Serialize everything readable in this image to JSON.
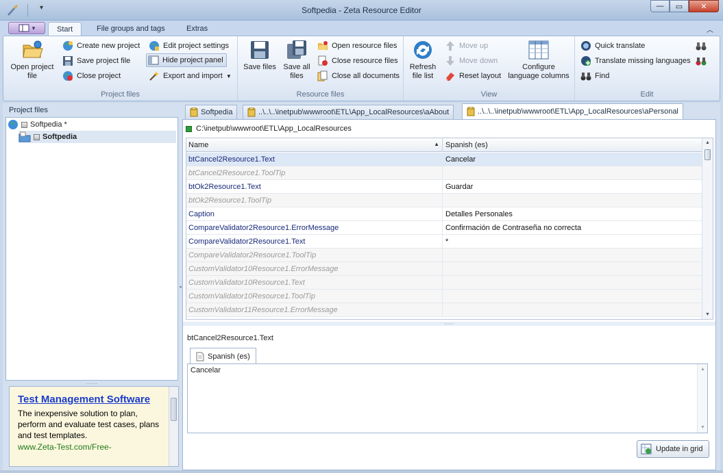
{
  "window": {
    "title": "Softpedia - Zeta Resource Editor"
  },
  "ribbon_tabs": [
    {
      "label": "Start",
      "active": true
    },
    {
      "label": "File groups and tags",
      "active": false
    },
    {
      "label": "Extras",
      "active": false
    }
  ],
  "ribbon": {
    "project_files": {
      "label": "Project files",
      "open_project_file": "Open project file",
      "create_new_project": "Create new project",
      "save_project_file": "Save project file",
      "close_project": "Close project",
      "edit_project_settings": "Edit project settings",
      "hide_project_panel": "Hide project panel",
      "export_and_import": "Export and import"
    },
    "resource_files": {
      "label": "Resource files",
      "save_files": "Save files",
      "save_all_files": "Save all files",
      "open_resource_files": "Open resource files",
      "close_resource_files": "Close resource files",
      "close_all_documents": "Close all documents"
    },
    "view": {
      "label": "View",
      "refresh_file_list": "Refresh file list",
      "move_up": "Move up",
      "move_down": "Move down",
      "reset_layout": "Reset layout",
      "configure_language_columns": "Configure language columns"
    },
    "edit": {
      "label": "Edit",
      "quick_translate": "Quick translate",
      "translate_missing_languages": "Translate missing languages",
      "find": "Find"
    }
  },
  "left_panel": {
    "header": "Project files",
    "tree": [
      {
        "label": "Softpedia *",
        "level": 0
      },
      {
        "label": "Softpedia",
        "level": 1,
        "selected": true
      }
    ],
    "ad": {
      "title": "Test Management Software",
      "body": "The inexpensive solution to plan, perform and evaluate test cases, plans and test templates.",
      "url": "www.Zeta-Test.com/Free-"
    }
  },
  "doc_tabs": [
    {
      "label": "Softpedia",
      "active": false
    },
    {
      "label": "..\\..\\..\\inetpub\\wwwroot\\ETL\\App_LocalResources\\aAbout",
      "active": false
    },
    {
      "label": "..\\..\\..\\inetpub\\wwwroot\\ETL\\App_LocalResources\\aPersonal",
      "active": true
    }
  ],
  "path": "C:\\inetpub\\wwwroot\\ETL\\App_LocalResources",
  "grid": {
    "columns": [
      "Name",
      "Spanish (es)"
    ],
    "rows": [
      {
        "name": "btCancel2Resource1.Text",
        "es": "Cancelar",
        "tooltip": false,
        "selected": true
      },
      {
        "name": "btCancel2Resource1.ToolTip",
        "es": "",
        "tooltip": true
      },
      {
        "name": "btOk2Resource1.Text",
        "es": "Guardar",
        "tooltip": false
      },
      {
        "name": "btOk2Resource1.ToolTip",
        "es": "",
        "tooltip": true
      },
      {
        "name": "Caption",
        "es": "Detalles Personales",
        "tooltip": false
      },
      {
        "name": "CompareValidator2Resource1.ErrorMessage",
        "es": "Confirmación de Contraseña no correcta",
        "tooltip": false
      },
      {
        "name": "CompareValidator2Resource1.Text",
        "es": "*",
        "tooltip": false
      },
      {
        "name": "CompareValidator2Resource1.ToolTip",
        "es": "",
        "tooltip": true
      },
      {
        "name": "CustomValidator10Resource1.ErrorMessage",
        "es": "",
        "tooltip": true
      },
      {
        "name": "CustomValidator10Resource1.Text",
        "es": "",
        "tooltip": true
      },
      {
        "name": "CustomValidator10Resource1.ToolTip",
        "es": "",
        "tooltip": true
      },
      {
        "name": "CustomValidator11Resource1.ErrorMessage",
        "es": "",
        "tooltip": true
      }
    ]
  },
  "detail": {
    "key": "btCancel2Resource1.Text",
    "language_tab": "Spanish (es)",
    "value": "Cancelar",
    "update_button": "Update in grid"
  },
  "colors": {
    "accent": "#1a3ccc",
    "ad_url": "#217a19",
    "row_selected": "#dde8f6"
  }
}
